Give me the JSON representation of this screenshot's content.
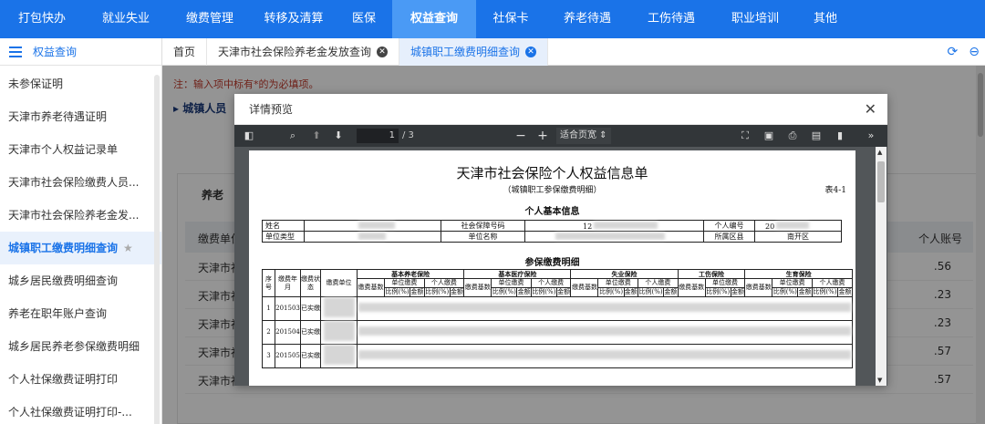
{
  "topnav": {
    "items": [
      {
        "label": "打包快办"
      },
      {
        "label": "就业失业"
      },
      {
        "label": "缴费管理"
      },
      {
        "label": "转移及清算"
      },
      {
        "label": "医保"
      },
      {
        "label": "权益查询",
        "active": true
      },
      {
        "label": "社保卡"
      },
      {
        "label": "养老待遇"
      },
      {
        "label": "工伤待遇"
      },
      {
        "label": "职业培训"
      },
      {
        "label": "其他"
      }
    ]
  },
  "sidebar": {
    "header": "权益查询",
    "items": [
      {
        "label": "未参保证明"
      },
      {
        "label": "天津市养老待遇证明"
      },
      {
        "label": "天津市个人权益记录单"
      },
      {
        "label": "天津市社会保险缴费人员..."
      },
      {
        "label": "天津市社会保险养老金发..."
      },
      {
        "label": "城镇职工缴费明细查询",
        "active": true
      },
      {
        "label": "城乡居民缴费明细查询"
      },
      {
        "label": "养老在职年账户查询"
      },
      {
        "label": "城乡居民养老参保缴费明细"
      },
      {
        "label": "个人社保缴费证明打印"
      },
      {
        "label": "个人社保缴费证明打印-..."
      }
    ]
  },
  "tabs": [
    {
      "label": "首页"
    },
    {
      "label": "天津市社会保险养老金发放查询"
    },
    {
      "label": "城镇职工缴费明细查询",
      "active": true
    }
  ],
  "content": {
    "notice": "注：输入项中标有*的为必填项。",
    "section_title": "城镇人员",
    "panel_tab": "养老",
    "table_head_left": "缴费单位",
    "table_head_right": "个人账号",
    "rows": [
      {
        "unit": "天津市社",
        "value": ".56"
      },
      {
        "unit": "天津市社",
        "value": ".23"
      },
      {
        "unit": "天津市社",
        "value": ".23"
      },
      {
        "unit": "天津市社",
        "value": ".57"
      },
      {
        "unit": "天津市社",
        "value": ".57"
      }
    ]
  },
  "modal": {
    "title": "详情预览",
    "toolbar": {
      "current_page": "1",
      "total_pages": "/ 3",
      "zoom": "适合页宽"
    },
    "document": {
      "title": "天津市社会保险个人权益信息单",
      "subtitle": "（城镇职工参保缴费明细）",
      "form_code": "表4-1",
      "basic_section": "个人基本信息",
      "info_labels": {
        "name": "姓名",
        "ssn": "社会保障号码",
        "person_no": "个人编号",
        "unit_type": "单位类型",
        "unit_name": "单位名称",
        "district": "所属区县"
      },
      "info_values": {
        "ssn_prefix": "12",
        "person_no_prefix": "20",
        "district": "南开区"
      },
      "detail_section": "参保缴费明细",
      "detail_headers": {
        "seq": "序号",
        "month": "缴费年月",
        "status": "缴费状态",
        "unit": "缴费单位",
        "pension": "基本养老保险",
        "medical": "基本医疗保险",
        "unemployment": "失业保险",
        "injury": "工伤保险",
        "maternity": "生育保险",
        "base": "缴费基数",
        "unit_pay": "单位缴费",
        "personal_pay": "个人缴费",
        "ratio": "比例(%)",
        "amount": "金额"
      },
      "detail_rows": [
        {
          "seq": "1",
          "month": "201503",
          "status": "已实缴"
        },
        {
          "seq": "2",
          "month": "201504",
          "status": "已实缴"
        },
        {
          "seq": "3",
          "month": "201505",
          "status": "已实缴"
        }
      ]
    }
  }
}
